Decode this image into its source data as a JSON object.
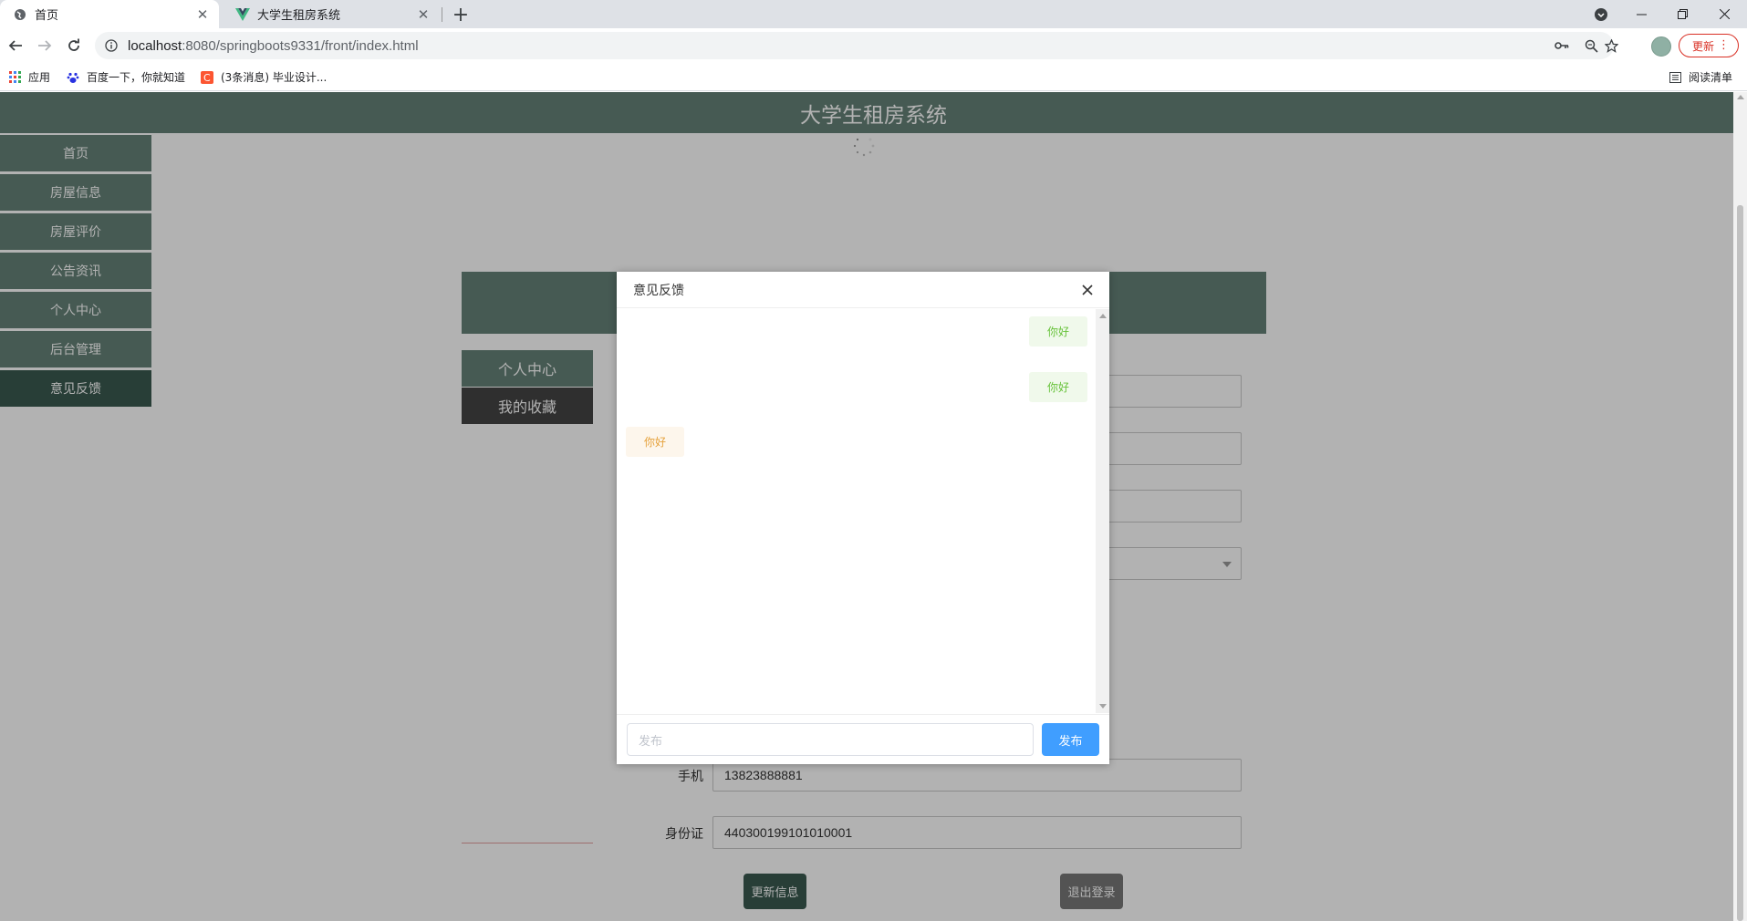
{
  "browser": {
    "tabs": [
      {
        "title": "首页",
        "active": true
      },
      {
        "title": "大学生租房系统",
        "active": false
      }
    ],
    "url_host": "localhost",
    "url_path": ":8080/springboots9331/front/index.html",
    "update_label": "更新",
    "bookmarks": [
      {
        "label": "应用",
        "icon": "apps-icon"
      },
      {
        "label": "百度一下，你就知道",
        "icon": "baidu-paw-icon"
      },
      {
        "label": "(3条消息) 毕业设计...",
        "icon": "csdn-icon"
      }
    ],
    "reading_list_label": "阅读清单"
  },
  "site": {
    "title": "大学生租房系统",
    "header_color": "#658278",
    "nav": [
      {
        "label": "首页",
        "active": false
      },
      {
        "label": "房屋信息",
        "active": false
      },
      {
        "label": "房屋评价",
        "active": false
      },
      {
        "label": "公告资讯",
        "active": false
      },
      {
        "label": "个人中心",
        "active": false
      },
      {
        "label": "后台管理",
        "active": false
      },
      {
        "label": "意见反馈",
        "active": true
      }
    ]
  },
  "user_center": {
    "tabs": [
      "个人中心",
      "我的收藏"
    ],
    "fields": [
      {
        "label": "手机",
        "value": "13823888881"
      },
      {
        "label": "身份证",
        "value": "440300199101010001"
      }
    ],
    "update_button": "更新信息",
    "logout_button": "退出登录"
  },
  "dialog": {
    "title": "意见反馈",
    "messages": [
      {
        "side": "right",
        "text": "你好"
      },
      {
        "side": "right",
        "text": "你好"
      },
      {
        "side": "left",
        "text": "你好"
      }
    ],
    "input_placeholder": "发布",
    "send_label": "发布",
    "accent": "#409eff"
  }
}
